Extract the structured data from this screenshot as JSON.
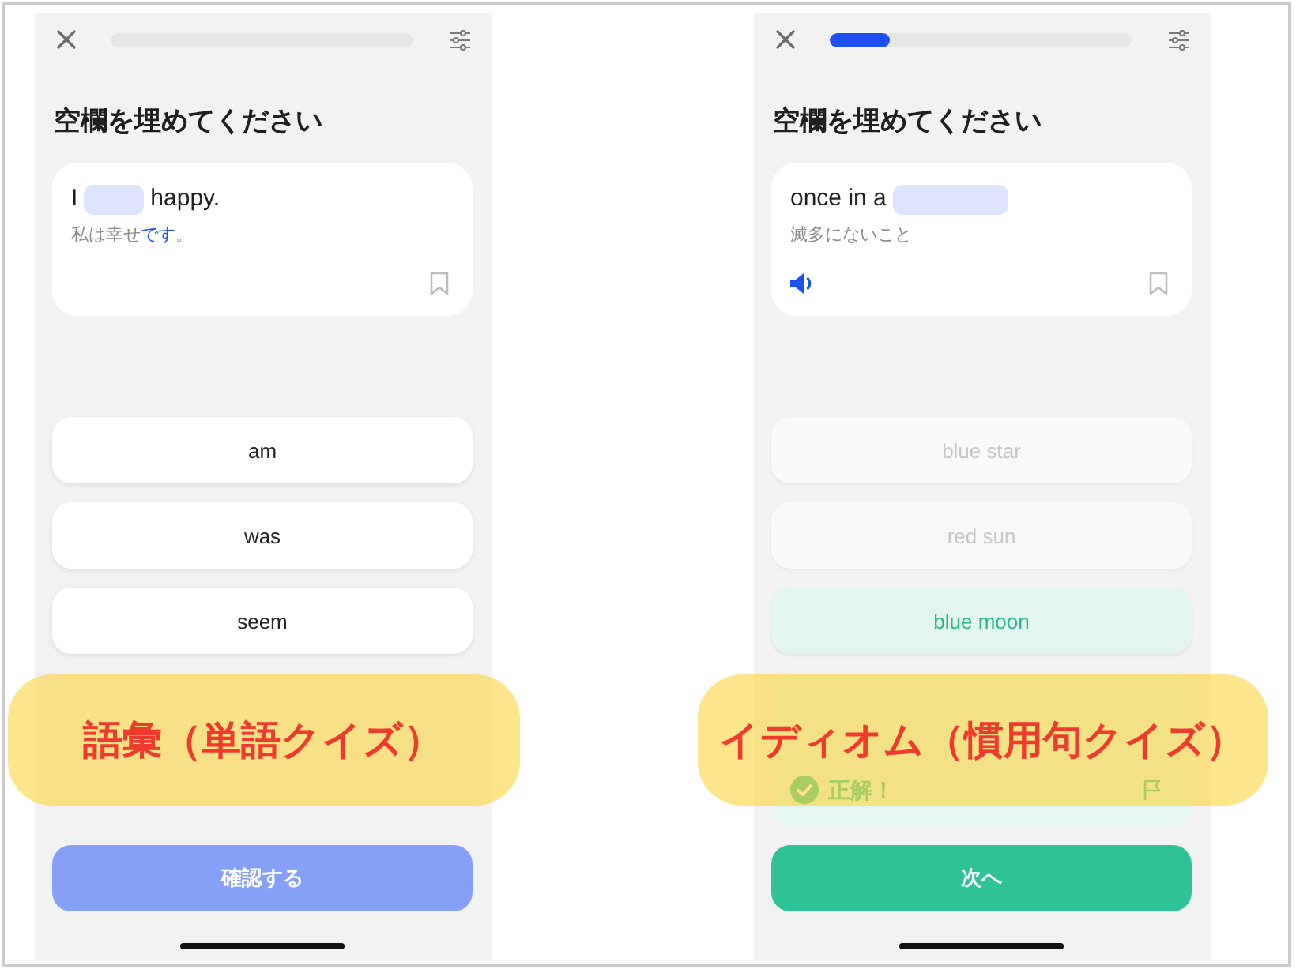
{
  "panels": [
    {
      "caption": "語彙（単語クイズ）",
      "screen": {
        "title": "空欄を埋めてください",
        "question": {
          "sentence": [
            {
              "kind": "text",
              "text": "I"
            },
            {
              "kind": "blank"
            },
            {
              "kind": "text",
              "text": "happy."
            }
          ],
          "translation": [
            {
              "text": "私は幸せ",
              "highlighted": false
            },
            {
              "text": "です",
              "highlighted": true
            },
            {
              "text": "。",
              "highlighted": false
            }
          ],
          "audio": false,
          "bookmarked": false
        },
        "options": [
          {
            "label": "am",
            "disabled": false,
            "correct": false
          },
          {
            "label": "was",
            "disabled": false,
            "correct": false
          },
          {
            "label": "seem",
            "disabled": false,
            "correct": false
          }
        ],
        "action_button": {
          "kind": "confirm",
          "label": "確認する",
          "disabled": true
        }
      }
    },
    {
      "caption": "イディオム（慣用句クイズ）",
      "screen": {
        "progress": {
          "level": 0.2
        },
        "title": "空欄を埋めてください",
        "question": {
          "sentence": [
            {
              "kind": "text",
              "text": "once in a"
            },
            {
              "kind": "blank"
            }
          ],
          "translation": [
            {
              "text": "滅多にないこと",
              "highlighted": false
            }
          ],
          "audio": true,
          "bookmarked": false
        },
        "options": [
          {
            "label": "blue star",
            "disabled": true,
            "correct": false
          },
          {
            "label": "red sun",
            "disabled": true,
            "correct": false
          },
          {
            "label": "blue moon",
            "disabled": true,
            "correct": true
          }
        ],
        "feedback": {
          "kind": "correct",
          "text": "正解！"
        },
        "action_button": {
          "kind": "next",
          "label": "次へ",
          "disabled": false
        }
      }
    }
  ]
}
